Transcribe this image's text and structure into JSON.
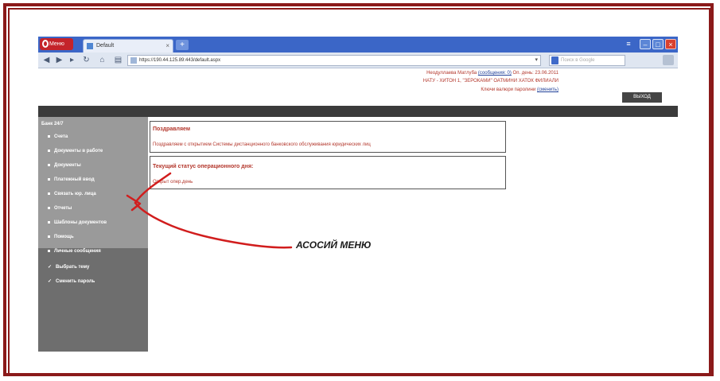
{
  "browser": {
    "menu_button": "Меню",
    "tab_title": "Default",
    "tab_close": "×",
    "new_tab": "+",
    "address": "https://190.44.125.89:443/default.aspx",
    "search_placeholder": "Поиск в Google"
  },
  "header": {
    "user_line": "Неодуллаева Матлуба",
    "messages_link": "(сообщения: 0)",
    "op_day": "Оп. день: 23.06.2011",
    "org_line": "НАТУ - ХИТОН 1, \"ЗЕРОКАМИ\" ОАТМИНИ ХАТОК ФИЛИАЛИ",
    "password_text": "Ключи валюри паролини",
    "password_link": "(сменить)",
    "logout_label": "ВЫХОД"
  },
  "sidebar": {
    "title": "Банк 24/7",
    "items": [
      {
        "label": "Счета"
      },
      {
        "label": "Документы в работе"
      },
      {
        "label": "Документы"
      },
      {
        "label": "Платежный ввод"
      },
      {
        "label": "Связать юр. лица"
      },
      {
        "label": "Отчеты"
      },
      {
        "label": "Шаблоны документов"
      },
      {
        "label": "Помощь"
      },
      {
        "label": "Личные сообщения"
      }
    ],
    "sub_items": [
      {
        "label": "Выбрать тему"
      },
      {
        "label": "Сменить пароль"
      }
    ]
  },
  "main": {
    "greeting_title": "Поздравляем",
    "greeting_text": "Поздравляем с открытием Системы дистанционного банковского обслуживания юридических лиц",
    "status_title": "Текущий статус операционного дня:",
    "status_text": "Открыт опер.день"
  },
  "annotation": {
    "label": "АСОСИЙ МЕНЮ"
  }
}
